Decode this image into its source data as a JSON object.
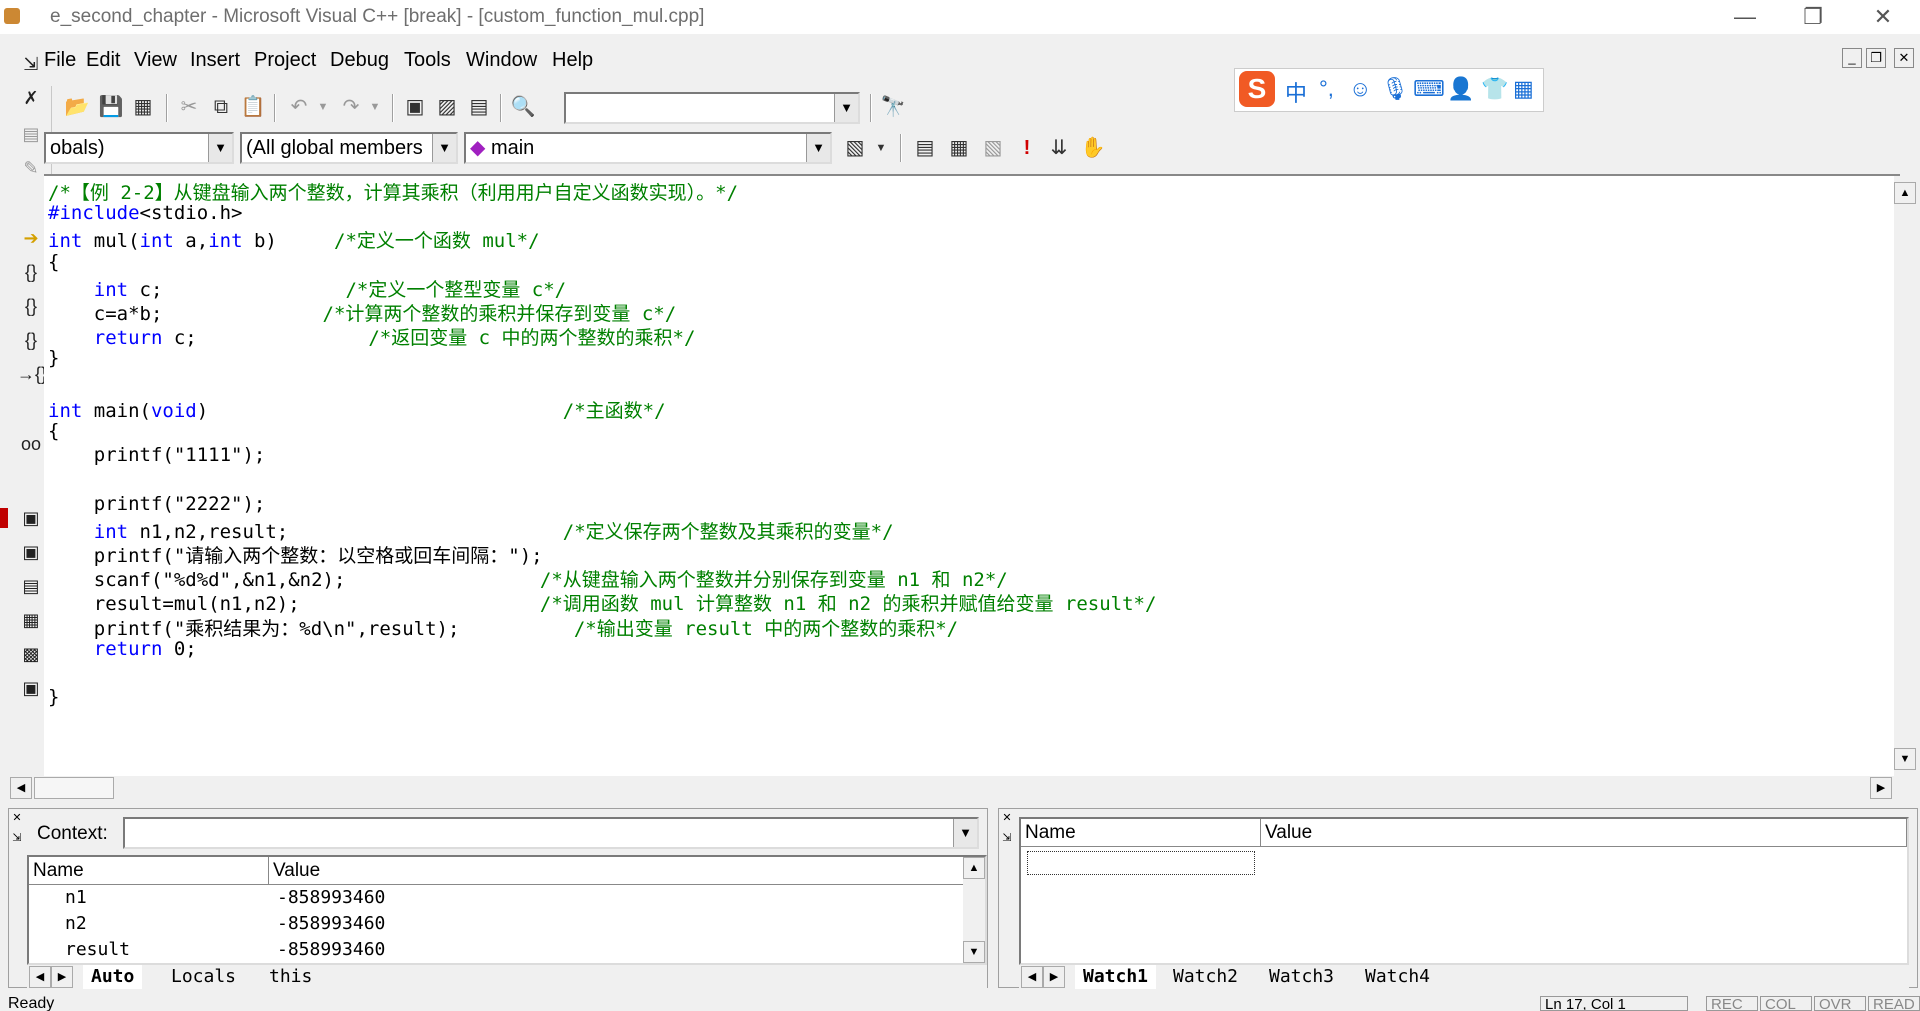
{
  "window": {
    "title": "e_second_chapter - Microsoft Visual C++ [break] - [custom_function_mul.cpp]",
    "minimize": "—",
    "restore": "❐",
    "close": "✕"
  },
  "menu": [
    {
      "label": "File"
    },
    {
      "label": "Edit"
    },
    {
      "label": "View"
    },
    {
      "label": "Insert"
    },
    {
      "label": "Project"
    },
    {
      "label": "Debug"
    },
    {
      "label": "Tools"
    },
    {
      "label": "Window"
    },
    {
      "label": "Help"
    }
  ],
  "toolbar": {
    "find_combo_value": "",
    "scope_combo_value": "obals)",
    "members_combo_value": "(All global members",
    "function_combo_value": "main"
  },
  "ime": {
    "logo": "S",
    "mode": "中",
    "punct": "°,"
  },
  "code_lines": [
    {
      "segments": [
        {
          "t": "/*【例 2-2】从键盘输入两个整数，计算其乘积（利用用户自定义函数实现）。*/",
          "c": "cm"
        }
      ]
    },
    {
      "segments": [
        {
          "t": "#include",
          "c": "kw"
        },
        {
          "t": "<stdio.h>",
          "c": ""
        }
      ]
    },
    {
      "segments": [
        {
          "t": "int",
          "c": "kw"
        },
        {
          "t": " mul(",
          "c": ""
        },
        {
          "t": "int",
          "c": "kw"
        },
        {
          "t": " a,",
          "c": ""
        },
        {
          "t": "int",
          "c": "kw"
        },
        {
          "t": " b)     ",
          "c": ""
        },
        {
          "t": "/*定义一个函数 mul*/",
          "c": "cm"
        }
      ]
    },
    {
      "segments": [
        {
          "t": "{",
          "c": ""
        }
      ]
    },
    {
      "segments": [
        {
          "t": "    ",
          "c": ""
        },
        {
          "t": "int",
          "c": "kw"
        },
        {
          "t": " c;                ",
          "c": ""
        },
        {
          "t": "/*定义一个整型变量 c*/",
          "c": "cm"
        }
      ]
    },
    {
      "segments": [
        {
          "t": "    c=a*b;              ",
          "c": ""
        },
        {
          "t": "/*计算两个整数的乘积并保存到变量 c*/",
          "c": "cm"
        }
      ]
    },
    {
      "segments": [
        {
          "t": "    ",
          "c": ""
        },
        {
          "t": "return",
          "c": "kw"
        },
        {
          "t": " c;               ",
          "c": ""
        },
        {
          "t": "/*返回变量 c 中的两个整数的乘积*/",
          "c": "cm"
        }
      ]
    },
    {
      "segments": [
        {
          "t": "}",
          "c": ""
        }
      ]
    },
    {
      "segments": []
    },
    {
      "segments": [
        {
          "t": "int",
          "c": "kw"
        },
        {
          "t": " main(",
          "c": ""
        },
        {
          "t": "void",
          "c": "kw"
        },
        {
          "t": ")                               ",
          "c": ""
        },
        {
          "t": "/*主函数*/",
          "c": "cm"
        }
      ]
    },
    {
      "segments": [
        {
          "t": "{",
          "c": ""
        }
      ]
    },
    {
      "segments": [
        {
          "t": "    printf(\"1111\");",
          "c": ""
        }
      ]
    },
    {
      "segments": []
    },
    {
      "segments": [
        {
          "t": "    printf(\"2222\");",
          "c": ""
        }
      ]
    },
    {
      "segments": [
        {
          "t": "    ",
          "c": ""
        },
        {
          "t": "int",
          "c": "kw"
        },
        {
          "t": " n1,n2,result;                        ",
          "c": ""
        },
        {
          "t": "/*定义保存两个整数及其乘积的变量*/",
          "c": "cm"
        }
      ]
    },
    {
      "segments": [
        {
          "t": "    printf(\"请输入两个整数：以空格或回车间隔：\");",
          "c": ""
        }
      ]
    },
    {
      "segments": [
        {
          "t": "    scanf(\"%d%d\",&n1,&n2);                 ",
          "c": ""
        },
        {
          "t": "/*从键盘输入两个整数并分别保存到变量 n1 和 n2*/",
          "c": "cm"
        }
      ]
    },
    {
      "segments": [
        {
          "t": "    result=mul(n1,n2);                     ",
          "c": ""
        },
        {
          "t": "/*调用函数 mul 计算整数 n1 和 n2 的乘积并赋值给变量 result*/",
          "c": "cm"
        }
      ]
    },
    {
      "segments": [
        {
          "t": "    printf(\"乘积结果为：%d\\n\",result);          ",
          "c": ""
        },
        {
          "t": "/*输出变量 result 中的两个整数的乘积*/",
          "c": "cm"
        }
      ]
    },
    {
      "segments": [
        {
          "t": "    ",
          "c": ""
        },
        {
          "t": "return",
          "c": "kw"
        },
        {
          "t": " 0;",
          "c": ""
        }
      ]
    },
    {
      "segments": []
    },
    {
      "segments": [
        {
          "t": "}",
          "c": ""
        }
      ]
    }
  ],
  "variables": {
    "context_label": "Context:",
    "context_value": "",
    "headers": {
      "name": "Name",
      "value": "Value"
    },
    "rows": [
      {
        "name": "n1",
        "value": "-858993460"
      },
      {
        "name": "n2",
        "value": "-858993460"
      },
      {
        "name": "result",
        "value": "-858993460"
      }
    ],
    "tabs": [
      "Auto",
      "Locals",
      "this"
    ]
  },
  "watch": {
    "headers": {
      "name": "Name",
      "value": "Value"
    },
    "tabs": [
      "Watch1",
      "Watch2",
      "Watch3",
      "Watch4"
    ]
  },
  "status": {
    "text": "Ready",
    "position": "Ln 17, Col 1",
    "rec": "REC",
    "col": "COL",
    "ovr": "OVR",
    "read": "READ"
  },
  "colors": {
    "keyword": "#0000ff",
    "comment": "#008000"
  }
}
